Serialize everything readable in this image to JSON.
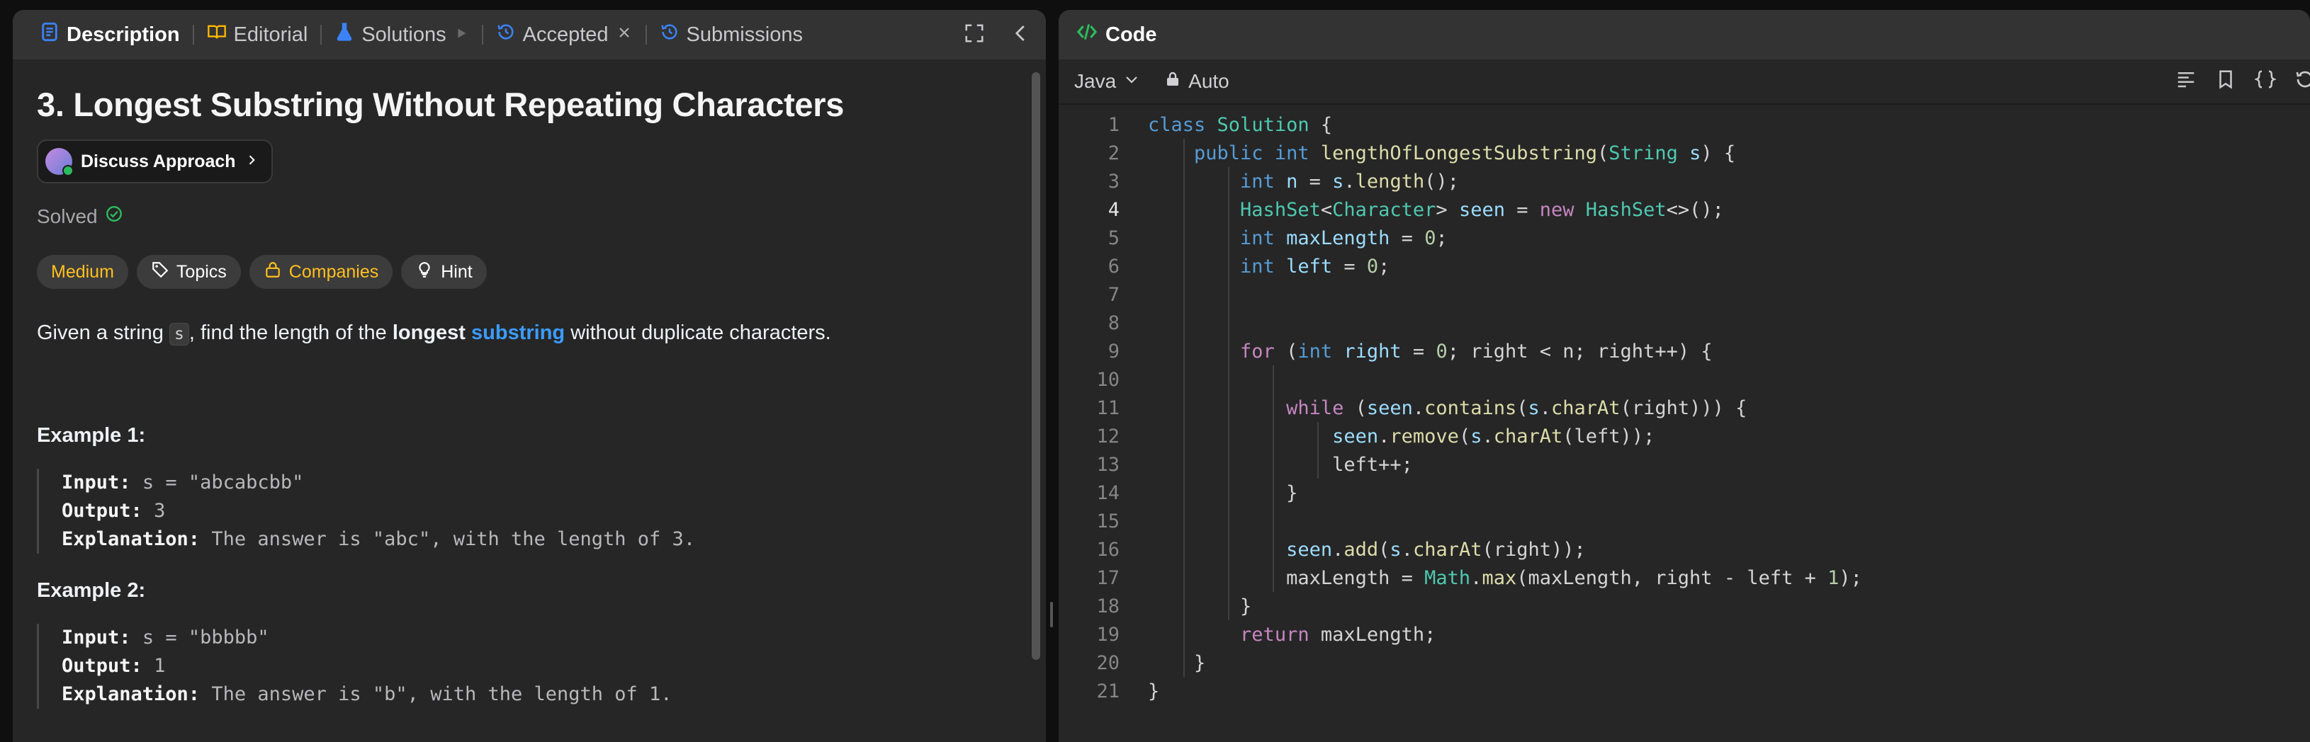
{
  "left_tabs": [
    {
      "label": "Description",
      "icon": "description-icon"
    },
    {
      "label": "Editorial",
      "icon": "book-icon"
    },
    {
      "label": "Solutions",
      "icon": "flask-icon"
    },
    {
      "label": "Accepted",
      "icon": "history-icon"
    },
    {
      "label": "Submissions",
      "icon": "history-icon"
    }
  ],
  "problem": {
    "title": "3. Longest Substring Without Repeating Characters",
    "discuss_label": "Discuss Approach",
    "status": "Solved",
    "chips": [
      "Medium",
      "Topics",
      "Companies",
      "Hint"
    ],
    "desc_pre": "Given a string ",
    "desc_code": "s",
    "desc_mid": ", find the length of the ",
    "desc_bold": "longest",
    "desc_link": "substring",
    "desc_post": " without duplicate characters."
  },
  "examples": [
    {
      "title": "Example 1:",
      "input_label": "Input:",
      "input": "s = \"abcabcbb\"",
      "output_label": "Output:",
      "output": "3",
      "explanation_label": "Explanation:",
      "explanation": "The answer is \"abc\", with the length of 3."
    },
    {
      "title": "Example 2:",
      "input_label": "Input:",
      "input": "s = \"bbbbb\"",
      "output_label": "Output:",
      "output": "1",
      "explanation_label": "Explanation:",
      "explanation": "The answer is \"b\", with the length of 1."
    }
  ],
  "code_panel": {
    "title": "Code",
    "language": "Java",
    "mode": "Auto",
    "active_line": 4,
    "lines": [
      "class Solution {",
      "    public int lengthOfLongestSubstring(String s) {",
      "        int n = s.length();",
      "        HashSet<Character> seen = new HashSet<>();",
      "        int maxLength = 0;",
      "        int left = 0;",
      "",
      "",
      "        for (int right = 0; right < n; right++) {",
      "",
      "            while (seen.contains(s.charAt(right))) {",
      "                seen.remove(s.charAt(left));",
      "                left++;",
      "            }",
      "",
      "            seen.add(s.charAt(right));",
      "            maxLength = Math.max(maxLength, right - left + 1);",
      "        }",
      "        return maxLength;",
      "    }",
      "}"
    ]
  },
  "colors": {
    "accent_blue": "#3b9cff",
    "medium": "#ffc01e",
    "solved_green": "#2cbb5d",
    "code_icon_green": "#2cbb5d"
  }
}
